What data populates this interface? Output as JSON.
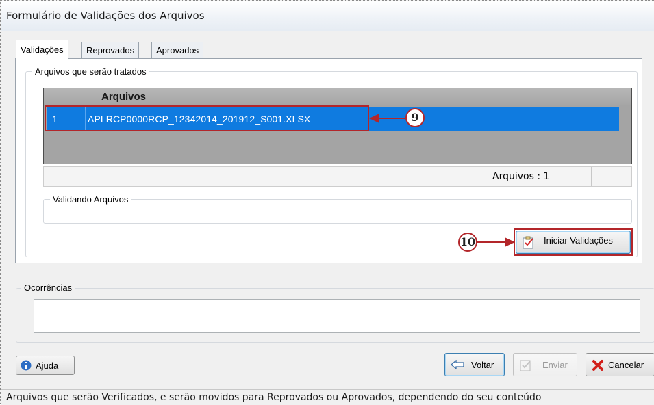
{
  "window": {
    "title": "Formulário de Validações dos Arquivos"
  },
  "tabs": [
    {
      "label": "Validações",
      "active": true
    },
    {
      "label": "Reprovados",
      "active": false
    },
    {
      "label": "Aprovados",
      "active": false
    }
  ],
  "files_group": {
    "legend": "Arquivos que serão tratados",
    "grid": {
      "column_header": "Arquivos",
      "rows": [
        {
          "index": "1",
          "file": "APLRCP0000RCP_12342014_201912_S001.XLSX",
          "selected": true
        }
      ],
      "count_label": "Arquivos : 1"
    }
  },
  "validating_group": {
    "legend": "Validando Arquivos"
  },
  "start_button": {
    "label": "Iniciar Validações",
    "icon": "checklist-icon"
  },
  "callouts": {
    "first": "9",
    "second": "10"
  },
  "occurrences_group": {
    "legend": "Ocorrências",
    "text": ""
  },
  "footer": {
    "help_label": "Ajuda",
    "back_label": "Voltar",
    "send_label": "Enviar",
    "cancel_label": "Cancelar"
  },
  "status_bar": {
    "text": "Arquivos que serão Verificados, e serão movidos para Reprovados ou Aprovados, dependendo do seu conteúdo"
  },
  "colors": {
    "selection": "#0f7be0",
    "highlight": "#b3262a",
    "grid_bg": "#a4a4a4"
  }
}
